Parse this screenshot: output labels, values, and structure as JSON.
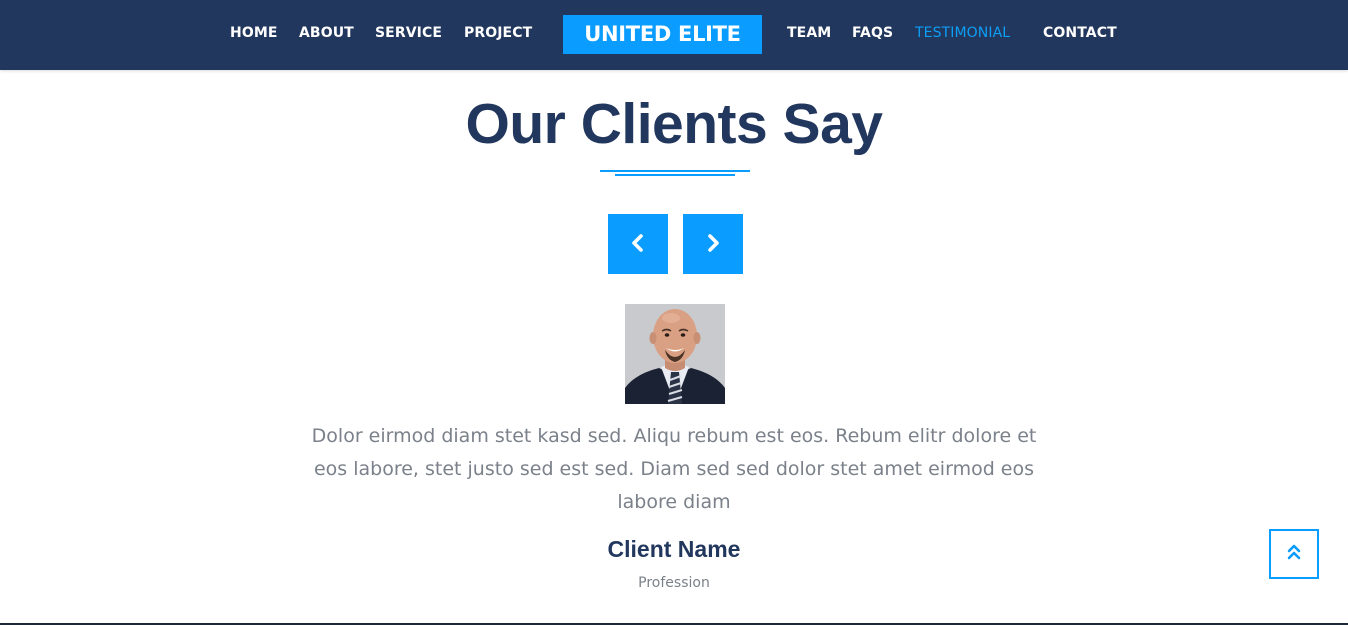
{
  "nav": {
    "items": [
      {
        "label": "HOME"
      },
      {
        "label": "ABOUT"
      },
      {
        "label": "SERVICE"
      },
      {
        "label": "PROJECT"
      },
      {
        "label": "TEAM"
      },
      {
        "label": "FAQS"
      },
      {
        "label": "TESTIMONIAL",
        "active": true
      },
      {
        "label": "CONTACT"
      }
    ],
    "brand": "UNITED ELITE"
  },
  "section": {
    "title": "Our Clients Say"
  },
  "carousel": {
    "prev_icon": "chevron-left-icon",
    "next_icon": "chevron-right-icon"
  },
  "testimonial": {
    "text": "Dolor eirmod diam stet kasd sed. Aliqu rebum est eos. Rebum elitr dolore et eos labore, stet justo sed est sed. Diam sed sed dolor stet amet eirmod eos labore diam",
    "client_name": "Client Name",
    "profession": "Profession"
  },
  "back_to_top": {
    "icon": "double-chevron-up-icon"
  },
  "colors": {
    "navbar_bg": "#22375d",
    "accent": "#0a9cff",
    "heading": "#22375d",
    "body_text": "#7b818a"
  }
}
